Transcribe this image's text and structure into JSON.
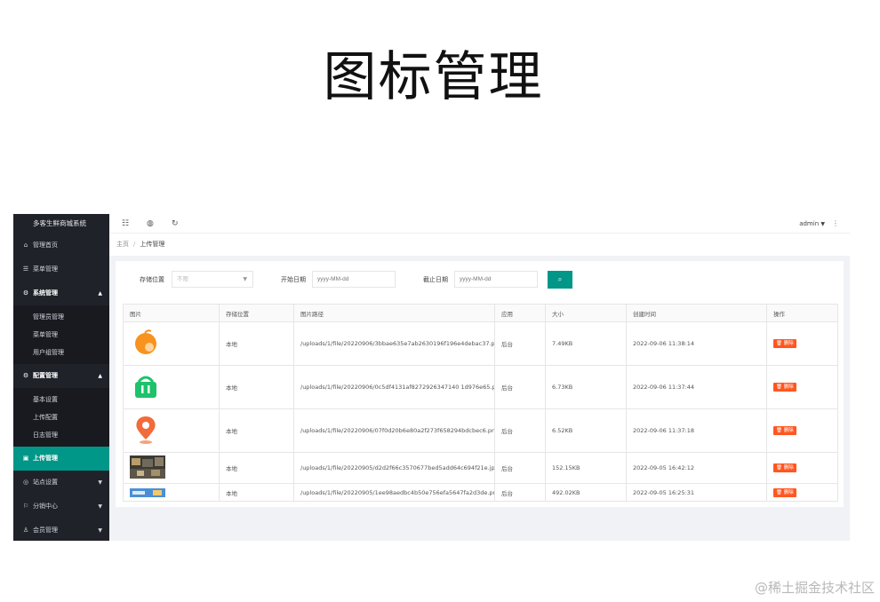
{
  "slide": {
    "title": "图标管理"
  },
  "sidebar": {
    "brand": "多客生鲜商城系统",
    "items": [
      {
        "label": "管理首页",
        "icon": "home-icon"
      },
      {
        "label": "菜单管理",
        "icon": "list-icon"
      },
      {
        "label": "系统管理",
        "icon": "gear-icon",
        "expanded": true,
        "children": [
          {
            "label": "管理员管理"
          },
          {
            "label": "菜单管理"
          },
          {
            "label": "用户组管理"
          }
        ]
      },
      {
        "label": "配置管理",
        "icon": "gear-icon",
        "expanded": true,
        "children": [
          {
            "label": "基本设置"
          },
          {
            "label": "上传配置"
          },
          {
            "label": "日志管理"
          }
        ]
      },
      {
        "label": "上传管理",
        "icon": "image-icon",
        "active": true
      },
      {
        "label": "站点设置",
        "icon": "globe-icon"
      },
      {
        "label": "分销中心",
        "icon": "flag-icon"
      },
      {
        "label": "会员管理",
        "icon": "user-icon"
      }
    ]
  },
  "topbar": {
    "user": "admin"
  },
  "breadcrumb": {
    "home": "主页",
    "current": "上传管理"
  },
  "filter": {
    "storage_label": "存储位置",
    "storage_placeholder": "不限",
    "start_label": "开始日期",
    "start_placeholder": "yyyy-MM-dd",
    "end_label": "截止日期",
    "end_placeholder": "yyyy-MM-dd"
  },
  "table": {
    "columns": [
      "图片",
      "存储位置",
      "图片路径",
      "应用",
      "大小",
      "创建时间",
      "操作"
    ],
    "rows": [
      {
        "location": "本地",
        "path": "/uploads/1/file/20220906/3bbae635e7ab2630196f196e4debac37.png",
        "app": "后台",
        "size": "7.49KB",
        "created": "2022-09-06 11:38:14",
        "action": "删除",
        "thumb": "orange-fruit"
      },
      {
        "location": "本地",
        "path": "/uploads/1/file/20220906/0c5df4131af8272926347140 1d976e65.png",
        "app": "后台",
        "size": "6.73KB",
        "created": "2022-09-06 11:37:44",
        "action": "删除",
        "thumb": "green-basket"
      },
      {
        "location": "本地",
        "path": "/uploads/1/file/20220906/07f0d20b6e80a2f273f658294bdcbec6.png",
        "app": "后台",
        "size": "6.52KB",
        "created": "2022-09-06 11:37:18",
        "action": "删除",
        "thumb": "orange-pin"
      },
      {
        "location": "本地",
        "path": "/uploads/1/file/20220905/d2d2f66c3570677bed5add64c694f21e.jpg",
        "app": "后台",
        "size": "152.15KB",
        "created": "2022-09-05 16:42:12",
        "action": "删除",
        "thumb": "photo"
      },
      {
        "location": "本地",
        "path": "/uploads/1/file/20220905/1ee98aedbc4b50e756efa5647fa2d3de.png",
        "app": "后台",
        "size": "492.02KB",
        "created": "2022-09-05 16:25:31",
        "action": "删除",
        "thumb": "banner"
      }
    ]
  },
  "watermark": "@稀土掘金技术社区",
  "colors": {
    "accent": "#009688",
    "danger": "#ff5722",
    "sidebar_bg": "#20222a"
  }
}
